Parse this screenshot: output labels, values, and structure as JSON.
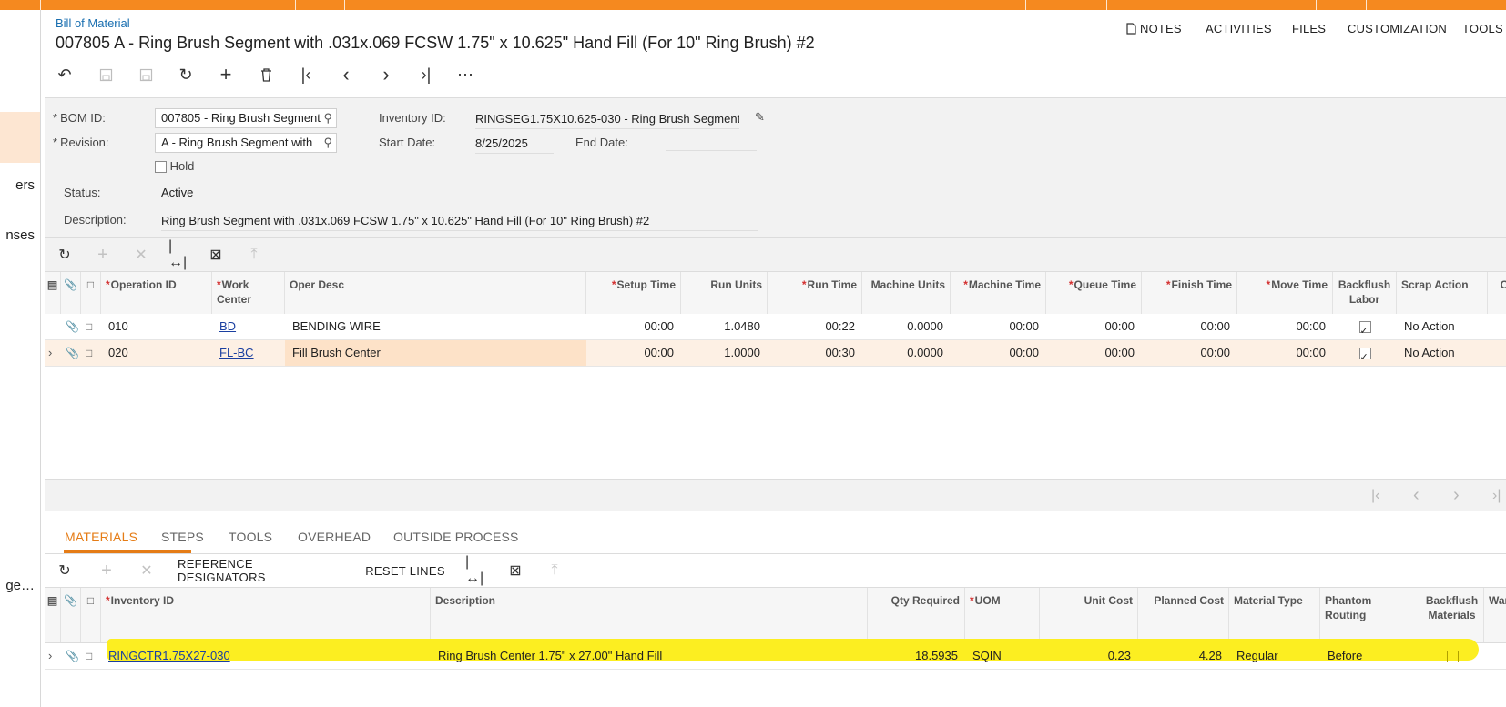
{
  "breadcrumb": "Bill of Material",
  "title": "007805 A - Ring Brush Segment with .031x.069 FCSW 1.75\" x 10.625\" Hand Fill (For 10\" Ring Brush) #2",
  "left_nav": [
    "ers",
    "nses",
    "ge…"
  ],
  "top_menu": {
    "notes": "NOTES",
    "activities": "ACTIVITIES",
    "files": "FILES",
    "customization": "CUSTOMIZATION",
    "tools": "TOOLS"
  },
  "icons": {
    "notes": "document-icon",
    "undo": "undo-icon",
    "save_close": "save-close-icon",
    "save": "save-icon",
    "cancel": "cancel-icon",
    "add": "plus-icon",
    "delete": "trash-icon",
    "first": "first-icon",
    "prev": "prev-icon",
    "next": "next-icon",
    "last": "last-icon",
    "more": "more-icon",
    "refresh": "refresh-icon",
    "fit": "fit-columns-icon",
    "excel": "excel-icon",
    "upload": "upload-icon",
    "lens": "search-icon",
    "pencil": "pencil-icon",
    "paperclip": "paperclip-icon",
    "document": "document-icon",
    "expand": "chevron-right-icon"
  },
  "form": {
    "bom_id_label": "BOM ID:",
    "bom_id_value": "007805 - Ring Brush Segment",
    "revision_label": "Revision:",
    "revision_value": "A - Ring Brush Segment with",
    "hold_label": "Hold",
    "hold_checked": false,
    "status_label": "Status:",
    "status_value": "Active",
    "description_label": "Description:",
    "description_value": "Ring Brush Segment with .031x.069 FCSW 1.75\" x 10.625\" Hand Fill (For 10\" Ring Brush) #2",
    "inventory_label": "Inventory ID:",
    "inventory_value": "RINGSEG1.75X10.625-030 - Ring Brush Segment",
    "start_date_label": "Start Date:",
    "start_date_value": "8/25/2025",
    "end_date_label": "End Date:",
    "end_date_value": ""
  },
  "operations": {
    "headers": {
      "operation_id": "Operation ID",
      "work_center": "Work Center",
      "oper_desc": "Oper Desc",
      "setup_time": "Setup Time",
      "run_units": "Run Units",
      "run_time": "Run Time",
      "machine_units": "Machine Units",
      "machine_time": "Machine Time",
      "queue_time": "Queue Time",
      "finish_time": "Finish Time",
      "move_time": "Move Time",
      "backflush_labor": "Backflush Labor",
      "scrap_action": "Scrap Action",
      "control_point": "Control Point"
    },
    "rows": [
      {
        "operation_id": "010",
        "work_center": "BD",
        "oper_desc": "BENDING WIRE",
        "setup_time": "00:00",
        "run_units": "1.0480",
        "run_time": "00:22",
        "machine_units": "0.0000",
        "machine_time": "00:00",
        "queue_time": "00:00",
        "finish_time": "00:00",
        "move_time": "00:00",
        "backflush_labor": true,
        "scrap_action": "No Action",
        "control_point": false
      },
      {
        "operation_id": "020",
        "work_center": "FL-BC",
        "oper_desc": "Fill Brush Center",
        "setup_time": "00:00",
        "run_units": "1.0000",
        "run_time": "00:30",
        "machine_units": "0.0000",
        "machine_time": "00:00",
        "queue_time": "00:00",
        "finish_time": "00:00",
        "move_time": "00:00",
        "backflush_labor": true,
        "scrap_action": "No Action",
        "control_point": false
      }
    ]
  },
  "tabs": [
    "MATERIALS",
    "STEPS",
    "TOOLS",
    "OVERHEAD",
    "OUTSIDE PROCESS"
  ],
  "materials_toolbar": {
    "reference_designators": "REFERENCE DESIGNATORS",
    "reset_lines": "RESET LINES"
  },
  "materials": {
    "headers": {
      "inventory_id": "Inventory ID",
      "description": "Description",
      "qty_required": "Qty Required",
      "uom": "UOM",
      "unit_cost": "Unit Cost",
      "planned_cost": "Planned Cost",
      "material_type": "Material Type",
      "phantom_routing": "Phantom Routing",
      "backflush_materials": "Backflush Materials",
      "warehouse": "Warehouse"
    },
    "rows": [
      {
        "inventory_id": "RINGCTR1.75X27-030",
        "description": "Ring Brush Center 1.75\" x 27.00\" Hand Fill",
        "qty_required": "18.5935",
        "uom": "SQIN",
        "unit_cost": "0.23",
        "planned_cost": "4.28",
        "material_type": "Regular",
        "phantom_routing": "Before",
        "backflush_materials": false
      }
    ]
  },
  "colors": {
    "accent_orange": "#f5891f",
    "tab_active": "#e57c16",
    "link": "#1a3fa0",
    "highlight": "#fcee21",
    "selected_row": "#fdf0e4"
  }
}
